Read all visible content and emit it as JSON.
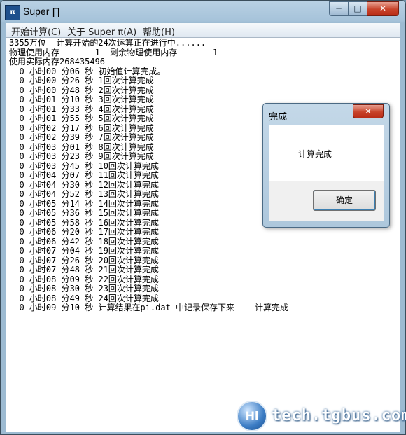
{
  "window": {
    "title": "Super ∏",
    "icon_text": "π",
    "min_glyph": "─",
    "max_glyph": "□",
    "close_glyph": "✕"
  },
  "menu": {
    "items": [
      {
        "label": "开始计算(C)"
      },
      {
        "label": "关于 Super π(A)"
      },
      {
        "label": "帮助(H)"
      }
    ]
  },
  "log": {
    "lines": [
      "3355万位  计算开始的24次运算正在进行中......",
      "物理使用内存      -1  剩余物理使用内存      -1",
      "使用实际内存268435496",
      "  0 小时00 分06 秒 初始值计算完成。",
      "  0 小时00 分26 秒 1回次计算完成",
      "  0 小时00 分48 秒 2回次计算完成",
      "  0 小时01 分10 秒 3回次计算完成",
      "  0 小时01 分33 秒 4回次计算完成",
      "  0 小时01 分55 秒 5回次计算完成",
      "  0 小时02 分17 秒 6回次计算完成",
      "  0 小时02 分39 秒 7回次计算完成",
      "  0 小时03 分01 秒 8回次计算完成",
      "  0 小时03 分23 秒 9回次计算完成",
      "  0 小时03 分45 秒 10回次计算完成",
      "  0 小时04 分07 秒 11回次计算完成",
      "  0 小时04 分30 秒 12回次计算完成",
      "  0 小时04 分52 秒 13回次计算完成",
      "  0 小时05 分14 秒 14回次计算完成",
      "  0 小时05 分36 秒 15回次计算完成",
      "  0 小时05 分58 秒 16回次计算完成",
      "  0 小时06 分20 秒 17回次计算完成",
      "  0 小时06 分42 秒 18回次计算完成",
      "  0 小时07 分04 秒 19回次计算完成",
      "  0 小时07 分26 秒 20回次计算完成",
      "  0 小时07 分48 秒 21回次计算完成",
      "  0 小时08 分09 秒 22回次计算完成",
      "  0 小时08 分30 秒 23回次计算完成",
      "  0 小时08 分49 秒 24回次计算完成",
      "  0 小时09 分10 秒 计算结果在pi.dat 中记录保存下来    计算完成"
    ]
  },
  "dialog": {
    "title": "完成",
    "message": "计算完成",
    "ok_label": "确定",
    "close_glyph": "✕"
  },
  "watermark": {
    "logo_text": "Hi",
    "text": "tech.tgbus.com"
  }
}
